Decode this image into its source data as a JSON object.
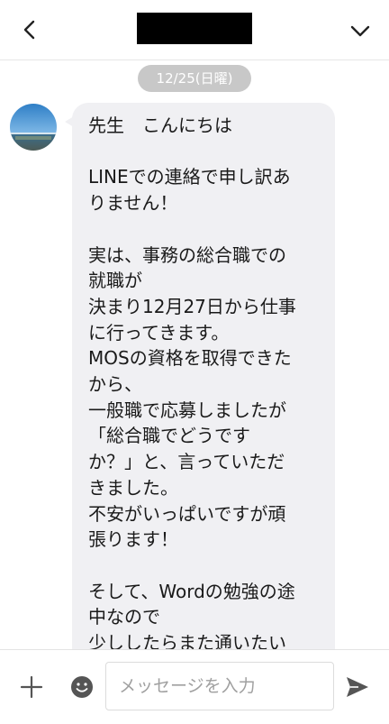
{
  "header": {
    "back_icon": "chevron-left-icon",
    "menu_icon": "chevron-down-icon"
  },
  "chat": {
    "date_separator": "12/25(日曜)",
    "message": {
      "text": "先生　こんにちは\n\nLINEでの連絡で申し訳あ\nりません！\n\n実は、事務の総合職での\n就職が\n決まり12月27日から仕事\nに行ってきます。\nMOSの資格を取得できた\nから、\n一般職で応募しましたが\n「総合職でどうです\nか？」と、言っていただ\nきました。\n不安がいっぱいですが頑\n張ります！\n\nそして、Wordの勉強の途\n中なので\n少ししたらまた通いたい"
    }
  },
  "input_bar": {
    "placeholder": "メッセージを入力",
    "plus_icon": "plus-icon",
    "emoji_icon": "emoji-icon",
    "send_icon": "send-icon"
  },
  "colors": {
    "bubble": "#f0f0f3",
    "date_pill": "#c8c8c8",
    "icon": "#555555"
  }
}
